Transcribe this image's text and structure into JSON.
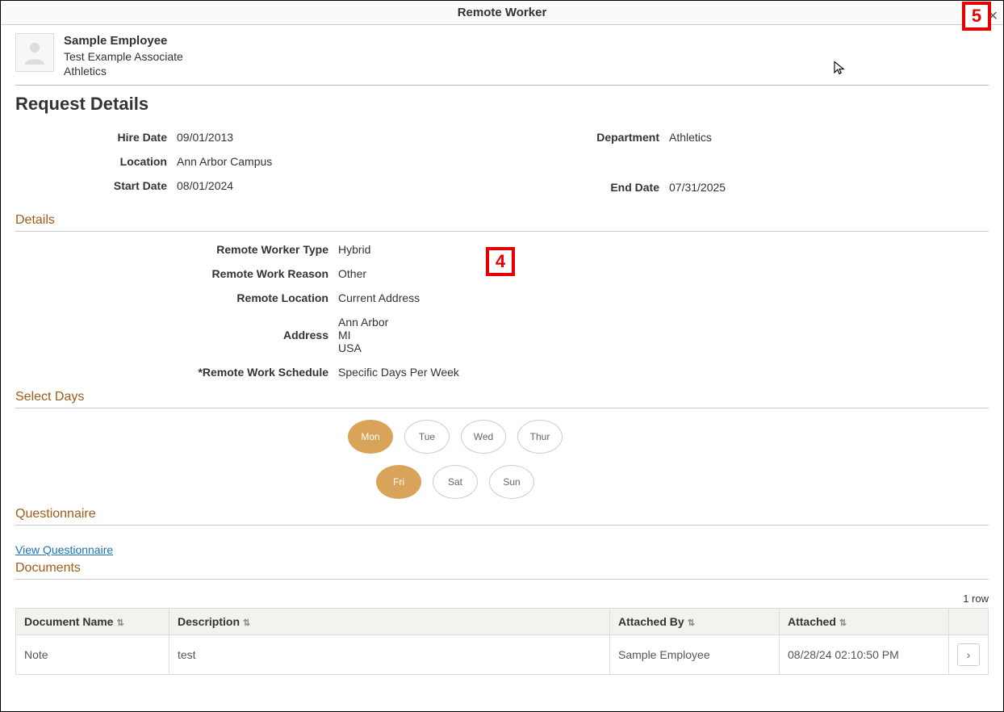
{
  "header": {
    "title": "Remote Worker"
  },
  "employee": {
    "name": "Sample Employee",
    "title": "Test Example Associate",
    "dept": "Athletics"
  },
  "pageTitle": "Request Details",
  "top": {
    "hireDate": {
      "label": "Hire Date",
      "value": "09/01/2013"
    },
    "department": {
      "label": "Department",
      "value": "Athletics"
    },
    "location": {
      "label": "Location",
      "value": "Ann Arbor Campus"
    },
    "startDate": {
      "label": "Start Date",
      "value": "08/01/2024"
    },
    "endDate": {
      "label": "End Date",
      "value": "07/31/2025"
    }
  },
  "sections": {
    "details": "Details",
    "selectDays": "Select Days",
    "questionnaire": "Questionnaire",
    "documents": "Documents"
  },
  "details": {
    "type": {
      "label": "Remote Worker Type",
      "value": "Hybrid"
    },
    "reason": {
      "label": "Remote Work Reason",
      "value": "Other"
    },
    "remoteLocation": {
      "label": "Remote Location",
      "value": "Current Address"
    },
    "address": {
      "label": "Address",
      "l1": "Ann Arbor",
      "l2": "MI",
      "l3": "USA"
    },
    "schedule": {
      "label": "*Remote Work Schedule",
      "value": "Specific Days Per Week"
    }
  },
  "days": {
    "mon": "Mon",
    "tue": "Tue",
    "wed": "Wed",
    "thur": "Thur",
    "fri": "Fri",
    "sat": "Sat",
    "sun": "Sun"
  },
  "questionnaire": {
    "link": "View Questionnaire"
  },
  "documents": {
    "rowCount": "1 row",
    "headers": {
      "name": "Document Name",
      "desc": "Description",
      "by": "Attached By",
      "at": "Attached"
    },
    "rows": [
      {
        "name": "Note",
        "desc": "test",
        "by": "Sample Employee",
        "at": "08/28/24 02:10:50 PM"
      }
    ]
  },
  "annotations": {
    "four": "4",
    "five": "5"
  }
}
